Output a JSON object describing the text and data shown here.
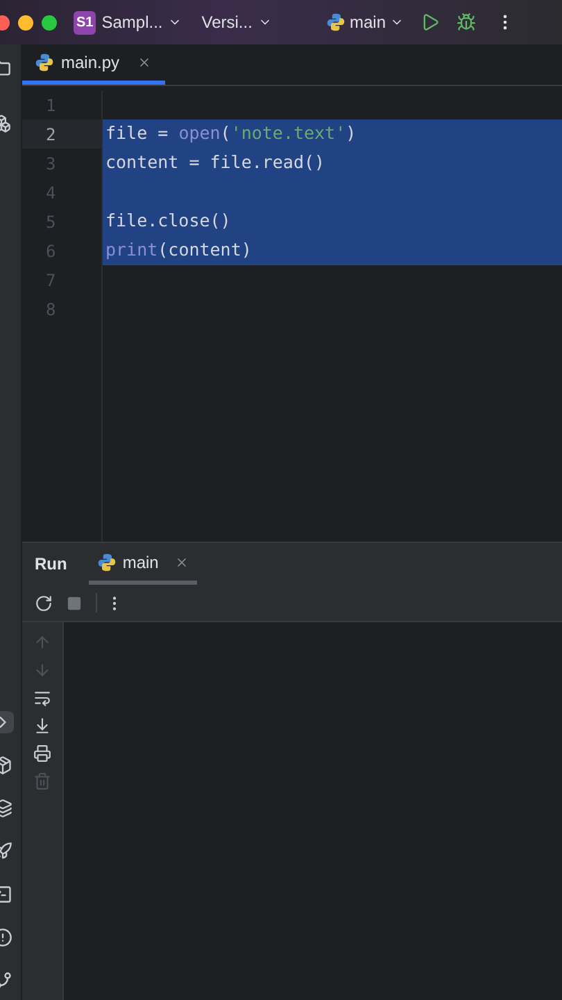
{
  "titlebar": {
    "project_badge": "S1",
    "project": "Sampl...",
    "vcs": "Versi...",
    "run_config": "main"
  },
  "editor_tabs": [
    {
      "label": "main.py",
      "selected": true
    }
  ],
  "code": {
    "lines": [
      {
        "number": "1",
        "selected": false,
        "current": false
      },
      {
        "number": "2",
        "selected": true,
        "current": true,
        "tokens": [
          {
            "text": "file = ",
            "kind": "plain"
          },
          {
            "text": "open",
            "kind": "builtin"
          },
          {
            "text": "(",
            "kind": "plain"
          },
          {
            "text": "'note.text'",
            "kind": "string"
          },
          {
            "text": ")",
            "kind": "plain"
          }
        ]
      },
      {
        "number": "3",
        "selected": true,
        "current": false,
        "tokens": [
          {
            "text": "content = file.read()",
            "kind": "plain"
          }
        ]
      },
      {
        "number": "4",
        "selected": true,
        "current": false
      },
      {
        "number": "5",
        "selected": true,
        "current": false,
        "tokens": [
          {
            "text": "file.close()",
            "kind": "plain"
          }
        ]
      },
      {
        "number": "6",
        "selected": true,
        "current": false,
        "tokens": [
          {
            "text": "print",
            "kind": "builtin"
          },
          {
            "text": "(content)",
            "kind": "plain"
          }
        ]
      },
      {
        "number": "7",
        "selected": false,
        "current": false
      },
      {
        "number": "8",
        "selected": false,
        "current": false
      }
    ]
  },
  "run_panel": {
    "title": "Run",
    "tabs": [
      {
        "label": "main",
        "selected": true
      }
    ],
    "side_tools": [
      {
        "kind": "up",
        "disabled": true
      },
      {
        "kind": "down",
        "disabled": true
      },
      {
        "kind": "wrap",
        "disabled": false
      },
      {
        "kind": "scroll",
        "disabled": false
      },
      {
        "kind": "print",
        "disabled": false
      },
      {
        "kind": "trash",
        "disabled": true
      }
    ]
  },
  "left_tools": [
    {
      "kind": "terminal",
      "selected": true
    },
    {
      "kind": "packages",
      "selected": false
    },
    {
      "kind": "layers",
      "selected": false
    },
    {
      "kind": "services",
      "selected": false
    },
    {
      "kind": "console",
      "selected": false
    },
    {
      "kind": "problems",
      "selected": false
    },
    {
      "kind": "git",
      "selected": false
    }
  ]
}
